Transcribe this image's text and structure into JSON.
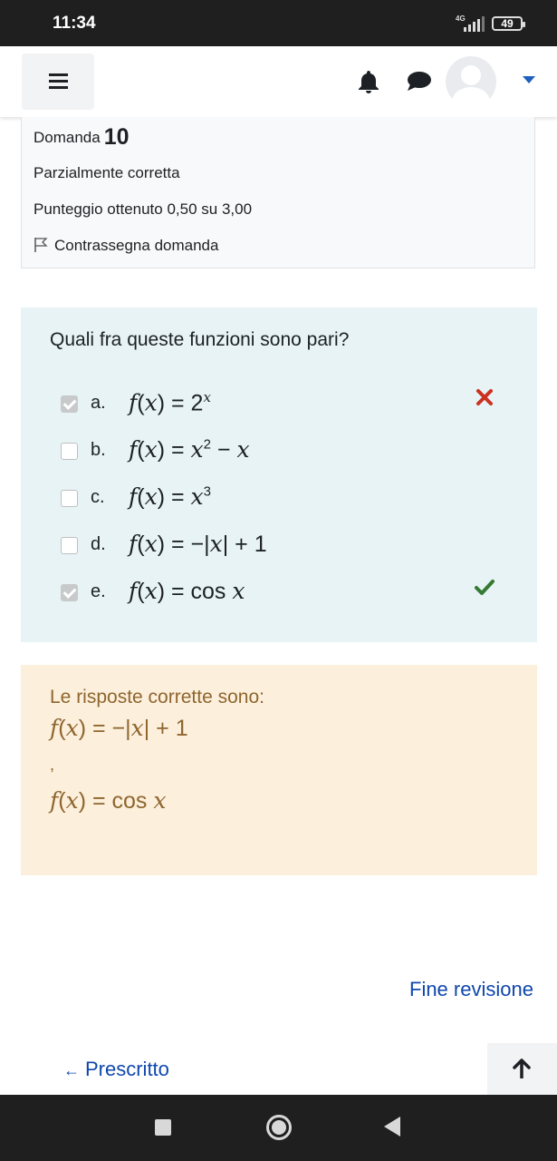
{
  "status_bar": {
    "time": "11:34",
    "network": "4G",
    "battery": "49"
  },
  "navbar": {
    "menu_icon": "hamburger-menu-icon",
    "notification_icon": "bell-icon",
    "messages_icon": "chat-bubble-icon",
    "user_menu_icon": "chevron-down-icon"
  },
  "question_info": {
    "label": "Domanda",
    "number": "10",
    "state": "Parzialmente corretta",
    "grade": "Punteggio ottenuto 0,50 su 3,00",
    "flag_label": "Contrassegna domanda"
  },
  "question": {
    "text": "Quali fra queste funzioni sono pari?",
    "options": [
      {
        "letter": "a.",
        "checked": true,
        "mark": "incorrect",
        "formula_plain": "f(x) = 2^x"
      },
      {
        "letter": "b.",
        "checked": false,
        "mark": "",
        "formula_plain": "f(x) = x^2 - x"
      },
      {
        "letter": "c.",
        "checked": false,
        "mark": "",
        "formula_plain": "f(x) = x^3"
      },
      {
        "letter": "d.",
        "checked": false,
        "mark": "",
        "formula_plain": "f(x) = -|x| + 1"
      },
      {
        "letter": "e.",
        "checked": true,
        "mark": "correct",
        "formula_plain": "f(x) = cos x"
      }
    ]
  },
  "feedback": {
    "title": "Le risposte corrette sono:",
    "answer1_plain": "f(x) = -|x| + 1",
    "separator": ",",
    "answer2_plain": "f(x) = cos x"
  },
  "navigation": {
    "finish_review": "Fine revisione",
    "previous_label": "Prescritto",
    "previous_arrow": "←",
    "back_to_top_icon": "arrow-up-icon"
  },
  "colors": {
    "link": "#0f47ad",
    "question_bg": "#e7f3f5",
    "feedback_bg": "#fcefdc",
    "feedback_text": "#8e662e",
    "incorrect": "#ca3120",
    "correct": "#357a32"
  }
}
